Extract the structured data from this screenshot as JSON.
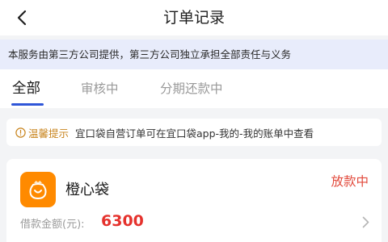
{
  "header": {
    "title": "订单记录",
    "back_icon": "chevron-left-icon"
  },
  "notice": {
    "text": "本服务由第三方公司提供，第三方公司独立承担全部责任与义务"
  },
  "tabs": [
    {
      "label": "全部",
      "active": true
    },
    {
      "label": "审核中",
      "active": false
    },
    {
      "label": "分期还款中",
      "active": false
    }
  ],
  "tip": {
    "icon": "info-circle-icon",
    "label": "温馨提示",
    "text": "宜口袋自营订单可在宜口袋app-我的-我的账单中查看"
  },
  "order": {
    "brand_name": "橙心袋",
    "brand_icon": "money-bag-icon",
    "status": "放款中",
    "amount_label": "借款金额(元):",
    "amount_value": "6300",
    "chevron_icon": "chevron-right-icon"
  },
  "colors": {
    "accent": "#2f56d8",
    "status_red": "#e24a3c",
    "brand_orange": "#ff8a00",
    "tip_label": "#c8841d",
    "notice_bg": "#e8ecfb"
  }
}
